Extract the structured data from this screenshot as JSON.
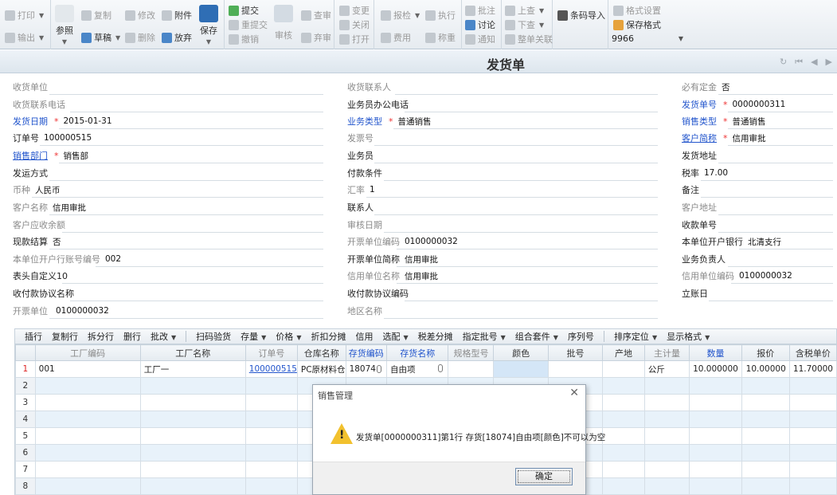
{
  "toolbar": {
    "print": "打印",
    "export": "输出",
    "reference": "参照",
    "copy": "复制",
    "draft": "草稿",
    "modify": "修改",
    "delete": "删除",
    "attachment": "附件",
    "abandon": "放弃",
    "save": "保存",
    "submit": "提交",
    "resubmit": "重提交",
    "revoke": "撤销",
    "audit": "审核",
    "view": "查审",
    "abandon_audit": "弃审",
    "change": "变更",
    "close": "关闭",
    "open": "打开",
    "report": "报检",
    "fee": "费用",
    "execute": "执行",
    "weigh": "称重",
    "annotate": "批注",
    "discuss": "讨论",
    "notify": "通知",
    "prev_lookup": "上查",
    "next_lookup": "下查",
    "whole_assoc": "整单关联",
    "barcode_import": "条码导入",
    "format_settings": "格式设置",
    "save_format": "保存格式",
    "format_value": "9966"
  },
  "title": "发货单",
  "header": {
    "receive_unit": "收货单位",
    "receive_contact": "收货联系人",
    "must_deposit": "必有定金",
    "must_deposit_value": "否",
    "receive_phone": "收货联系电话",
    "clerk_office_phone": "业务员办公电话",
    "delivery_no": "发货单号",
    "delivery_no_value": "0000000311",
    "delivery_date": "发货日期",
    "delivery_date_value": "2015-01-31",
    "biz_type": "业务类型",
    "biz_type_value": "普通销售",
    "sales_type": "销售类型",
    "sales_type_value": "普通销售",
    "order_no": "订单号",
    "order_no_value": "100000515",
    "invoice_no": "发票号",
    "customer_abbr": "客户简称",
    "customer_abbr_value": "信用审批",
    "sales_dept": "销售部门",
    "sales_dept_value": "销售部",
    "clerk": "业务员",
    "ship_address": "发货地址",
    "ship_method": "发运方式",
    "payment_terms": "付款条件",
    "tax_rate": "税率",
    "tax_rate_value": "17.00",
    "currency": "币种",
    "currency_value": "人民币",
    "exchange_rate": "汇率",
    "exchange_rate_value": "1",
    "remark": "备注",
    "customer_name": "客户名称",
    "customer_name_value": "信用审批",
    "contact": "联系人",
    "customer_address": "客户地址",
    "receivable_balance": "客户应收余额",
    "audit_date": "审核日期",
    "collection_no": "收款单号",
    "cash_settle": "现款结算",
    "cash_settle_value": "否",
    "invoice_unit_code": "开票单位编码",
    "invoice_unit_code_value": "0100000032",
    "bank": "本单位开户银行",
    "bank_value": "北清支行",
    "bank_account": "本单位开户行账号编号",
    "bank_account_value": "002",
    "invoice_unit_abbr": "开票单位简称",
    "invoice_unit_abbr_value": "信用审批",
    "biz_manager": "业务负责人",
    "custom10": "表头自定义10",
    "credit_unit_name": "信用单位名称",
    "credit_unit_name_value": "信用审批",
    "credit_unit_code": "信用单位编码",
    "credit_unit_code_value": "0100000032",
    "collect_agreement_name": "收付款协议名称",
    "collect_agreement_code": "收付款协议编码",
    "account_date": "立账日",
    "invoice_unit": "开票单位",
    "invoice_unit_value": "0100000032",
    "region_name": "地区名称"
  },
  "grid_toolbar": [
    {
      "label": "插行",
      "arrow": false
    },
    {
      "label": "复制行",
      "arrow": false
    },
    {
      "label": "拆分行",
      "arrow": false
    },
    {
      "label": "删行",
      "arrow": false
    },
    {
      "label": "批改",
      "arrow": true
    },
    {
      "label": "扫码验货",
      "arrow": false,
      "sep_before": true
    },
    {
      "label": "存量",
      "arrow": true
    },
    {
      "label": "价格",
      "arrow": true
    },
    {
      "label": "折扣分摊",
      "arrow": false
    },
    {
      "label": "信用",
      "arrow": false
    },
    {
      "label": "选配",
      "arrow": true
    },
    {
      "label": "税差分摊",
      "arrow": false
    },
    {
      "label": "指定批号",
      "arrow": true
    },
    {
      "label": "组合套件",
      "arrow": true
    },
    {
      "label": "序列号",
      "arrow": false
    },
    {
      "label": "排序定位",
      "arrow": true,
      "sep_before": true
    },
    {
      "label": "显示格式",
      "arrow": true
    }
  ],
  "table": {
    "columns": [
      "",
      "工厂编码",
      "工厂名称",
      "订单号",
      "仓库名称",
      "存货编码",
      "存货名称",
      "规格型号",
      "颜色",
      "批号",
      "产地",
      "主计量",
      "数量",
      "报价",
      "含税单价"
    ],
    "row1": {
      "num": "1",
      "factory_code": "001",
      "factory_name": "工厂一",
      "order_no": "100000515",
      "warehouse": "PC原材料仓",
      "inv_code": "18074",
      "inv_name": "自由项",
      "spec": "",
      "color": "",
      "batch": "",
      "origin": "",
      "uom": "公斤",
      "qty": "10.000000",
      "quote": "10.00000",
      "tax_price": "11.70000"
    },
    "row_numbers": [
      "2",
      "3",
      "4",
      "5",
      "6",
      "7",
      "8"
    ]
  },
  "dialog": {
    "title": "销售管理",
    "close": "✕",
    "message": "发货单[0000000311]第1行 存货[18074]自由项[颜色]不可以为空",
    "ok": "确定"
  }
}
